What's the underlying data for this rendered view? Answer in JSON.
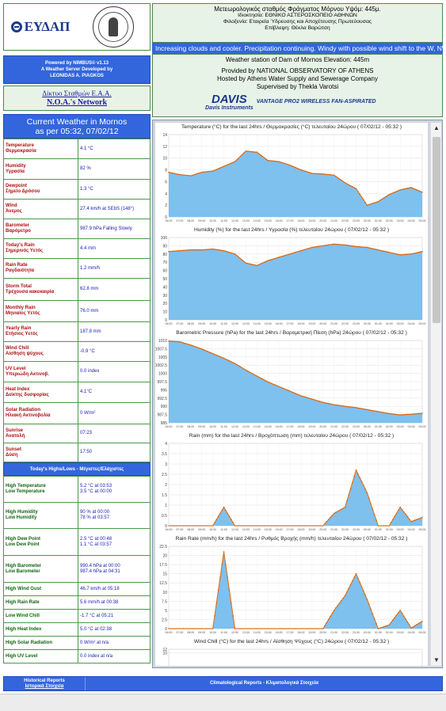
{
  "logos": {
    "eydap_text": "ΕΥΔΑΠ"
  },
  "powered": {
    "line1": "Powered by NIMBUS© v1.13",
    "line2": "A Weather Server Developed by",
    "line3": "LEONIDAS A. PIAGKOS"
  },
  "network": {
    "link1": "Δίκτυο Σταθμών Ε.Α.Α.",
    "link2": "N.O.A.'s Network"
  },
  "station_gr": {
    "line1": "Μετεωρολογικός σταθμός Φράγματος Μόρνου Υψόμ: 445μ.",
    "line2": "Ιδιοκτησία: ΕΘΝΙΚΟ ΑΣΤΕΡΟΣΚΟΠΕΙΟ ΑΘΗΝΩΝ",
    "line3": "Φιλοξενία: Εταιρεία Ύδρευσης και Αποχέτευσης Πρωτεύουσας",
    "line4": "Επίβλεψη: Θέκλα Βαρώτση"
  },
  "ticker": "Increasing clouds and cooler. Precipitation continuing. Windy with possible wind shift to the W, NW, or N.",
  "station_en": {
    "line1": "Weather station of Dam of Mornos Elevation: 445m",
    "line2": "Provided by NATIONAL OBSERVATORY OF ATHENS",
    "line3": "Hosted by Athens Water Supply and Sewerage Company",
    "line4": "Supervised by Thekla Varotsi",
    "davis_brand": "DAVIS",
    "davis_sub": "Davis Instruments",
    "davis_product": "VANTAGE PRO2 WIRELESS FAN-ASPIRATED"
  },
  "current": {
    "title_line1": "Current Weather in Mornos",
    "title_line2": "as per 05:32, 07/02/12",
    "rows": [
      {
        "en": "Temperature",
        "gr": "Θερμοκρασία",
        "value": "4.1 °C"
      },
      {
        "en": "Humidity",
        "gr": "Υγρασία",
        "value": "82 %"
      },
      {
        "en": "Dewpoint",
        "gr": "Σημείο Δρόσου",
        "value": "1.3 °C"
      },
      {
        "en": "Wind",
        "gr": "Άνεμος",
        "value": "27.4 km/h at SEbS (148°)"
      },
      {
        "en": "Barometer",
        "gr": "Βαρόμετρο",
        "value": "987.9 hPa Falling Slowly"
      },
      {
        "en": "Today's Rain",
        "gr": "Σημερινός Υετός",
        "value": "4.4 mm"
      },
      {
        "en": "Rain Rate",
        "gr": "Ραγδαιότητα",
        "value": "1.2 mm/h"
      },
      {
        "en": "Storm Total",
        "gr": "Τρέχουσα κακοκαιρία",
        "value": "62.8 mm"
      },
      {
        "en": "Monthly Rain",
        "gr": "Μηνιαίος Υετός",
        "value": "76.0 mm"
      },
      {
        "en": "Yearly Rain",
        "gr": "Ετήσιος Υετός",
        "value": "187.8 mm"
      },
      {
        "en": "Wind Chill",
        "gr": "Αίσθηση ψύχους",
        "value": "-0.9 °C"
      },
      {
        "en": "UV Level",
        "gr": "Υπεριώδη Ακτινοβ.",
        "value": "0.0 index"
      },
      {
        "en": "Heat Index",
        "gr": "Δείκτης δυσφορίας",
        "value": "4.1°C"
      },
      {
        "en": "Solar Radiation",
        "gr": "Ηλιακή Ακτινοβολία",
        "value": "0 W/m²"
      },
      {
        "en": "Sunrise",
        "gr": "Ανατολή",
        "value": "07:23"
      },
      {
        "en": "Sunset",
        "gr": "Δύση",
        "value": "17:50"
      }
    ]
  },
  "hilo": {
    "title": "Today's Highs/Lows - Μέγιστες/Ελάχιστες",
    "rows": [
      {
        "l1": "High Temperature",
        "l2": "Low Temperature",
        "v1": "5.2 °C at 03:53",
        "v2": "3.5 °C at 00:00"
      },
      {
        "l1": "High Humidity",
        "l2": "Low Humidity",
        "v1": "90 % at 00:00",
        "v2": "78 % at 03:57"
      },
      {
        "l1": "High Dew Point",
        "l2": "Low Dew Point",
        "v1": "2.5 °C at 00:48",
        "v2": "1.1 °C at 03:57"
      },
      {
        "l1": "High Barometer",
        "l2": "Low Barometer",
        "v1": "990.4 hPa at 00:00",
        "v2": "987.4 hPa at 04:31"
      },
      {
        "l1": "High Wind Gust",
        "l2": "",
        "v1": "46.7 km/h at 05:18",
        "v2": ""
      },
      {
        "l1": "High Rain Rate",
        "l2": "",
        "v1": "5.6 mm/h at 00:38",
        "v2": ""
      },
      {
        "l1": "Low Wind Chill",
        "l2": "",
        "v1": "-1.7 °C at 05:21",
        "v2": ""
      },
      {
        "l1": "High Heat Index",
        "l2": "",
        "v1": "5.0 °C at 02:38",
        "v2": ""
      },
      {
        "l1": "High Solar Radiation",
        "l2": "",
        "v1": "0 W/m² at n/a",
        "v2": ""
      },
      {
        "l1": "High UV Level",
        "l2": "",
        "v1": "0.0 index at n/a",
        "v2": ""
      }
    ]
  },
  "bottom": {
    "left1": "Historical Reports",
    "left2": "Ιστορικά Στοιχεία",
    "right": "Climatological Reports - Κλιματολογικά Στοιχεία"
  },
  "chart_data": [
    {
      "type": "area",
      "title": "Temperature (°C) for the last 24hrs / Θερμοκρασίες (°C) τελευταίου 24ώρου ( 07/02/12 - 05:32 )",
      "ylim": [
        0,
        14
      ],
      "yticks": [
        0,
        2,
        4,
        6,
        8,
        10,
        12,
        14
      ],
      "x": [
        "06:00",
        "07:00",
        "08:00",
        "09:00",
        "10:00",
        "11:00",
        "12:00",
        "13:00",
        "14:00",
        "15:00",
        "16:00",
        "17:00",
        "18:00",
        "19:00",
        "20:00",
        "21:00",
        "22:00",
        "23:00",
        "00:00",
        "01:00",
        "02:00",
        "03:00",
        "04:00",
        "05:00"
      ],
      "values": [
        7.6,
        7.2,
        7.0,
        7.6,
        7.8,
        8.6,
        9.4,
        11.2,
        11.0,
        9.6,
        9.4,
        8.8,
        8.0,
        7.4,
        7.3,
        7.1,
        5.8,
        4.8,
        2.0,
        2.6,
        3.8,
        4.6,
        5.0,
        4.2
      ]
    },
    {
      "type": "area",
      "title": "Humidity (%) for the last 24hrs / Υγρασία (%) τελευταίου 24ώρου ( 07/02/12 - 05:32 )",
      "ylim": [
        0,
        100
      ],
      "yticks": [
        0,
        10,
        20,
        30,
        40,
        50,
        60,
        70,
        80,
        90,
        100
      ],
      "x": [
        "06:00",
        "07:00",
        "08:00",
        "09:00",
        "10:00",
        "11:00",
        "12:00",
        "13:00",
        "14:00",
        "15:00",
        "16:00",
        "17:00",
        "18:00",
        "19:00",
        "20:00",
        "21:00",
        "22:00",
        "23:00",
        "00:00",
        "01:00",
        "02:00",
        "03:00",
        "04:00",
        "05:00"
      ],
      "values": [
        83,
        84,
        85,
        85,
        86,
        84,
        80,
        69,
        66,
        72,
        76,
        80,
        84,
        88,
        90,
        92,
        91,
        89,
        88,
        85,
        82,
        79,
        80,
        83
      ]
    },
    {
      "type": "area",
      "title": "Barometric Pressure (hPa) for the last 24hrs / Βαρομετρική Πίεση (hPa) 24ώρου ( 07/02/12 - 05:32 )",
      "ylim": [
        985,
        1010
      ],
      "yticks": [
        985,
        987.5,
        990,
        992.5,
        995,
        997.5,
        1000,
        1002.5,
        1005,
        1007.5,
        1010
      ],
      "x": [
        "06:00",
        "07:00",
        "08:00",
        "09:00",
        "10:00",
        "11:00",
        "12:00",
        "13:00",
        "14:00",
        "15:00",
        "16:00",
        "17:00",
        "18:00",
        "19:00",
        "20:00",
        "21:00",
        "22:00",
        "23:00",
        "00:00",
        "01:00",
        "02:00",
        "03:00",
        "04:00",
        "05:00"
      ],
      "values": [
        1009.8,
        1009.6,
        1008.6,
        1007.4,
        1006.0,
        1004.6,
        1003.0,
        1001.0,
        999.2,
        997.4,
        996.0,
        994.6,
        993.2,
        992.2,
        991.2,
        990.5,
        990.0,
        989.6,
        989.0,
        988.4,
        987.8,
        987.4,
        987.6,
        987.9
      ]
    },
    {
      "type": "area",
      "title": "Rain (mm) for the last 24hrs / Βροχόπτωση (mm) τελευταίου 24ώρου ( 07/02/12 - 05:32 )",
      "ylim": [
        0,
        4
      ],
      "yticks": [
        0,
        0.5,
        1,
        1.5,
        2,
        2.5,
        3,
        3.5,
        4
      ],
      "x": [
        "06:00",
        "07:00",
        "08:00",
        "09:00",
        "10:00",
        "11:00",
        "12:00",
        "13:00",
        "14:00",
        "15:00",
        "16:00",
        "17:00",
        "18:00",
        "19:00",
        "20:00",
        "21:00",
        "22:00",
        "23:00",
        "00:00",
        "01:00",
        "02:00",
        "03:00",
        "04:00",
        "05:00"
      ],
      "values": [
        0,
        0,
        0,
        0,
        0,
        0.9,
        0,
        0,
        0,
        0,
        0,
        0,
        0,
        0,
        0,
        0.6,
        0.9,
        2.7,
        1.6,
        0,
        0,
        0.9,
        0.2,
        0.4
      ]
    },
    {
      "type": "area",
      "title": "Rain Rate (mm/h) for the last 24hrs / Ρυθμός Βροχής (mm/h) τελευταίου 24ώρου ( 07/02/12 - 05:32 )",
      "ylim": [
        0,
        22.5
      ],
      "yticks": [
        0,
        2.5,
        5,
        7.5,
        10,
        12.5,
        15,
        17.5,
        20,
        22.5
      ],
      "x": [
        "06:00",
        "07:00",
        "08:00",
        "09:00",
        "10:00",
        "11:00",
        "12:00",
        "13:00",
        "14:00",
        "15:00",
        "16:00",
        "17:00",
        "18:00",
        "19:00",
        "20:00",
        "21:00",
        "22:00",
        "23:00",
        "00:00",
        "01:00",
        "02:00",
        "03:00",
        "04:00",
        "05:00"
      ],
      "values": [
        0,
        0,
        0,
        0,
        0,
        21.0,
        0,
        0,
        0,
        0,
        0,
        0,
        0,
        0,
        0,
        5.0,
        9.0,
        15.0,
        8.0,
        0,
        1.0,
        5.0,
        0.2,
        2.0
      ]
    },
    {
      "type": "line",
      "title": "Wind Chill (°C) for the last 24hrs / Αίσθηση Ψύχους (°C) 24ώρου ( 07/02/12 - 05:32 )",
      "ylim": [
        0,
        12
      ],
      "yticks": [
        10,
        12
      ],
      "x": [],
      "values": []
    }
  ]
}
